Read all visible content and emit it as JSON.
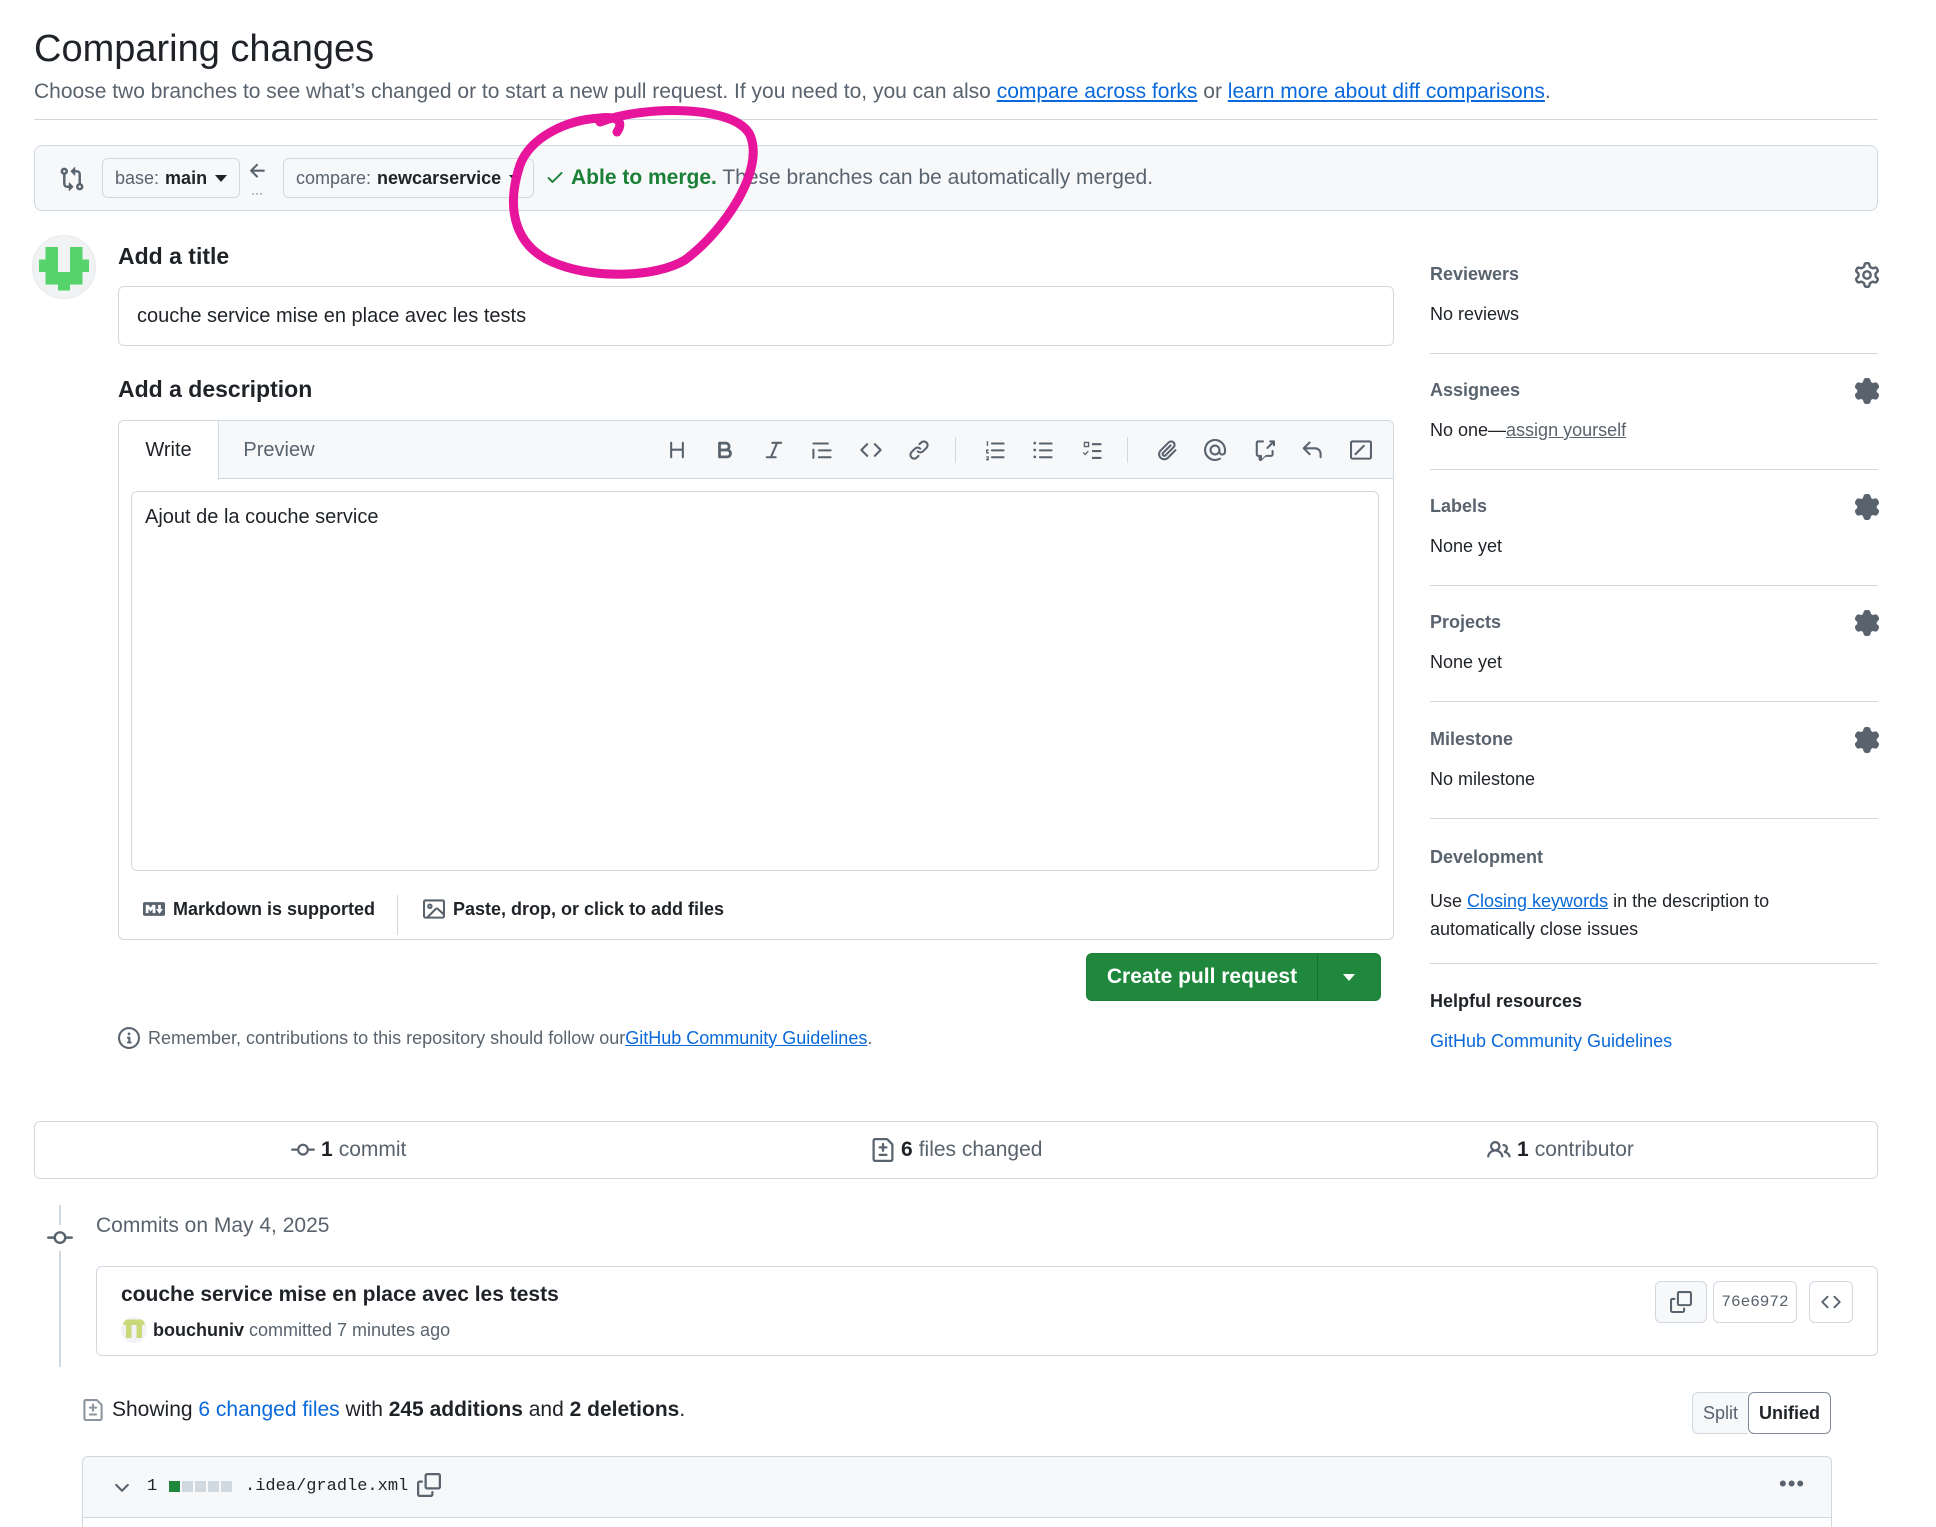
{
  "header": {
    "title": "Comparing changes",
    "subtitle_prefix": "Choose two branches to see what’s changed or to start a new pull request. If you need to, you can also ",
    "link_forks": "compare across forks",
    "subtitle_or": " or ",
    "link_learn": "learn more about diff comparisons",
    "subtitle_suffix": "."
  },
  "compare_bar": {
    "base_label": "base:",
    "base_branch": "main",
    "compare_label": "compare:",
    "compare_branch": "newcarservice",
    "merge_ok": "Able to merge.",
    "merge_text": " These branches can be automatically merged."
  },
  "form": {
    "title_heading": "Add a title",
    "title_value": "couche service mise en place avec les tests",
    "description_heading": "Add a description",
    "tab_write": "Write",
    "tab_preview": "Preview",
    "description_value": "Ajout de la couche service",
    "markdown_note": "Markdown is supported",
    "attach_note": "Paste, drop, or click to add files",
    "submit_label": "Create pull request",
    "guidelines_prefix": "Remember, contributions to this repository should follow our ",
    "guidelines_link": "GitHub Community Guidelines",
    "guidelines_suffix": "."
  },
  "sidebar": {
    "reviewers_label": "Reviewers",
    "reviewers_value": "No reviews",
    "assignees_label": "Assignees",
    "assignees_value": "No one—",
    "assignees_link": "assign yourself",
    "labels_label": "Labels",
    "labels_value": "None yet",
    "projects_label": "Projects",
    "projects_value": "None yet",
    "milestone_label": "Milestone",
    "milestone_value": "No milestone",
    "development_label": "Development",
    "development_prefix": "Use ",
    "development_link": "Closing keywords",
    "development_suffix_1": " in the description to",
    "development_suffix_2": "automatically close issues",
    "helpful_label": "Helpful resources",
    "helpful_link": "GitHub Community Guidelines"
  },
  "stats": {
    "commits_count": "1",
    "commits_label": "commit",
    "files_count": "6",
    "files_label": "files changed",
    "contributors_count": "1",
    "contributors_label": "contributor"
  },
  "commits": {
    "heading": "Commits on May 4, 2025",
    "items": [
      {
        "title": "couche service mise en place avec les tests",
        "author": "bouchuniv",
        "meta": "committed 7 minutes ago",
        "sha": "76e6972"
      }
    ]
  },
  "diff": {
    "showing": "Showing ",
    "changed_link": "6 changed files",
    "with": " with ",
    "additions": "245 additions",
    "and": " and ",
    "deletions": "2 deletions",
    "period": ".",
    "split_label": "Split",
    "unified_label": "Unified",
    "files": [
      {
        "changes": "1",
        "path": ".idea/gradle.xml"
      }
    ]
  },
  "colors": {
    "success": "#1a7f37",
    "primary_button": "#1f883d",
    "link": "#0969da",
    "annotation": "#e6159b"
  },
  "icons": [
    "git-compare-icon",
    "arrow-left-icon",
    "check-icon",
    "gear-icon",
    "heading-icon",
    "bold-icon",
    "italic-icon",
    "quote-icon",
    "code-icon",
    "link-icon",
    "ordered-list-icon",
    "unordered-list-icon",
    "task-list-icon",
    "paperclip-icon",
    "mention-icon",
    "cross-reference-icon",
    "reply-icon",
    "slash-icon",
    "markdown-icon",
    "image-icon",
    "info-icon",
    "commit-icon",
    "file-diff-icon",
    "people-icon",
    "copy-icon",
    "chevron-down-icon",
    "kebab-icon"
  ]
}
